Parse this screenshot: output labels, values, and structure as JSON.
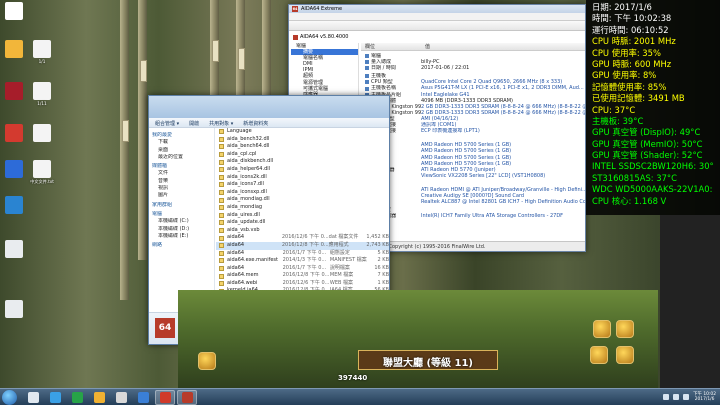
{
  "desktop": {
    "icons": [
      {
        "label": "",
        "color": "#ffffff"
      },
      {
        "label": "",
        "color": "#f2b63a"
      },
      {
        "label": "",
        "color": "#a61d2a"
      },
      {
        "label": "",
        "color": "#d33a2f"
      },
      {
        "label": "",
        "color": "#2d6bd8"
      },
      {
        "label": "",
        "color": "#2a84d1"
      },
      {
        "label": "",
        "color": "#e9ecef"
      },
      {
        "label": "",
        "color": "#e9ecef"
      }
    ],
    "col2_labels": [
      "1/1",
      "1/11",
      "",
      "中文文件.txt"
    ]
  },
  "osd": {
    "lines": [
      {
        "text": "日期: 2017/1/6",
        "color": "#ffffff"
      },
      {
        "text": "時間: 下午 10:02:38",
        "color": "#ffffff"
      },
      {
        "text": "運行時間: 06:10:52",
        "color": "#ffffff"
      },
      {
        "text": "CPU 時脈: 2001 MHz",
        "color": "#ffff00"
      },
      {
        "text": "CPU 使用率: 35%",
        "color": "#ffff00"
      },
      {
        "text": "GPU 時脈: 600 MHz",
        "color": "#ffff00"
      },
      {
        "text": "GPU 使用率: 8%",
        "color": "#ffff00"
      },
      {
        "text": "記憶體使用率: 85%",
        "color": "#ffff00"
      },
      {
        "text": "已使用記憶體: 3491 MB",
        "color": "#ffff00"
      },
      {
        "text": "CPU: 37°C",
        "color": "#ffff00"
      },
      {
        "text": "主機板: 39°C",
        "color": "#00ff00"
      },
      {
        "text": "GPU 真空管 (DispIO): 49°C",
        "color": "#00ff00"
      },
      {
        "text": "GPU 真空管 (MemIO): 50°C",
        "color": "#00ff00"
      },
      {
        "text": "GPU 真空管 (Shader): 52°C",
        "color": "#00ff00"
      },
      {
        "text": "INTEL SSDSC2BW120H6: 30°C",
        "color": "#00ff00"
      },
      {
        "text": "ST3160815AS: 37°C",
        "color": "#00ff00"
      },
      {
        "text": "WDC WD5000AAKS-22V1A0: 35°C",
        "color": "#00ff00"
      },
      {
        "text": "CPU 核心: 1.168 V",
        "color": "#00ff00"
      }
    ]
  },
  "aida": {
    "title": "AIDA64 Extreme",
    "version": "AIDA64 v5.80.4000",
    "tree": [
      {
        "label": "電腦",
        "cls": "open"
      },
      {
        "label": "摘要",
        "cls": "child selt"
      },
      {
        "label": "電腦名稱",
        "cls": "child"
      },
      {
        "label": "DMI",
        "cls": "child"
      },
      {
        "label": "IPMI",
        "cls": "child"
      },
      {
        "label": "超頻",
        "cls": "child"
      },
      {
        "label": "電源管理",
        "cls": "child"
      },
      {
        "label": "可攜式電腦",
        "cls": "child"
      },
      {
        "label": "感應器",
        "cls": "child"
      },
      {
        "label": "主機板",
        "cls": ""
      },
      {
        "label": "作業系統",
        "cls": ""
      },
      {
        "label": "伺服器",
        "cls": ""
      },
      {
        "label": "顯示",
        "cls": ""
      },
      {
        "label": "多媒體",
        "cls": ""
      },
      {
        "label": "存放裝置",
        "cls": ""
      },
      {
        "label": "網路",
        "cls": ""
      },
      {
        "label": "DirectX",
        "cls": ""
      },
      {
        "label": "裝置",
        "cls": ""
      },
      {
        "label": "軟體",
        "cls": ""
      },
      {
        "label": "安全性",
        "cls": ""
      },
      {
        "label": "組態",
        "cls": ""
      },
      {
        "label": "資料庫",
        "cls": ""
      },
      {
        "label": "效能測試",
        "cls": ""
      }
    ],
    "columns": [
      "欄位",
      "值"
    ],
    "rows": [
      {
        "k": "電腦",
        "v": "",
        "group": true
      },
      {
        "k": "量入總成",
        "v": "billy-PC",
        "plain": true
      },
      {
        "k": "日期 / 時間",
        "v": "2017-01-06 / 22:01",
        "plain": true
      },
      {
        "k": "主機板",
        "v": "",
        "group": true
      },
      {
        "k": "CPU 類型",
        "v": "QuadCore Intel Core 2 Quad Q9650, 2666 MHz (8 x 333)"
      },
      {
        "k": "主機板名稱",
        "v": "Asus P5G41T-M LX (1 PCI-E x16, 1 PCI-E x1, 2 DDR3 DIMM, Aud..."
      },
      {
        "k": "主機板晶片組",
        "v": "Intel Eaglelake G41"
      },
      {
        "k": "系統記憶體",
        "v": "4096 MB (DDR3-1333 DDR3 SDRAM)",
        "plain": true
      },
      {
        "k": "DIMM1: Kingston 99U5403-1...",
        "v": "2 GB DDR3-1333 DDR3 SDRAM (8-8-8-24 @ 666 MHz) (8-8-8-22 @..."
      },
      {
        "k": "DIMM3: Kingston 99U5403-1...",
        "v": "2 GB DDR3-1333 DDR3 SDRAM (8-8-8-24 @ 666 MHz) (8-8-8-22 @..."
      },
      {
        "k": "BIOS 類型",
        "v": "AMI (04/16/12)"
      },
      {
        "k": "通訊埠連接",
        "v": "通訊埠 (COM1)"
      },
      {
        "k": "通訊埠連接",
        "v": "ECP 印表機連接埠 (LPT1)"
      },
      {
        "k": "顯示",
        "v": "",
        "group": true
      },
      {
        "k": "顯示卡",
        "v": "AMD Radeon HD 5700 Series (1 GB)"
      },
      {
        "k": "顯示卡",
        "v": "AMD Radeon HD 5700 Series (1 GB)"
      },
      {
        "k": "顯示卡",
        "v": "AMD Radeon HD 5700 Series (1 GB)"
      },
      {
        "k": "顯示卡",
        "v": "AMD Radeon HD 5700 Series (1 GB)"
      },
      {
        "k": "3D 加速器",
        "v": "ATI Radeon HD 5770 (Juniper)"
      },
      {
        "k": "顯示器",
        "v": "ViewSonic VX2208 Series [22\" LCD] (VST1H0808)"
      },
      {
        "k": "多媒體",
        "v": "",
        "group": true
      },
      {
        "k": "音效卡",
        "v": "ATI Radeon HDMI @ ATI Juniper/Broadway/Granville - High Defini..."
      },
      {
        "k": "音效卡",
        "v": "Creative Audigy SE [0000?D] Sound Card"
      },
      {
        "k": "音效卡",
        "v": "Realtek ALC887 @ Intel 82801 GB ICH7 - High Definition Audio Con..."
      },
      {
        "k": "存放裝置",
        "v": "",
        "group": true
      },
      {
        "k": "IDE 控制器",
        "v": "Intel(R) ICH7 Family Ultra ATA Storage Controllers - 27DF"
      }
    ],
    "status": "Copyright (c) 1995-2016 FinalWire Ltd."
  },
  "explorer": {
    "toolbar": [
      "組合管理 ▾",
      "開啟",
      "共用對象 ▾",
      "新增資料夾"
    ],
    "nav": [
      {
        "label": "我的最愛",
        "sec": true
      },
      {
        "label": "下載",
        "sec": false
      },
      {
        "label": "桌面",
        "sec": false
      },
      {
        "label": "最近的位置",
        "sec": false
      },
      {
        "label": "媒體櫃",
        "sec": true
      },
      {
        "label": "文件",
        "sec": false
      },
      {
        "label": "音樂",
        "sec": false
      },
      {
        "label": "視訊",
        "sec": false
      },
      {
        "label": "圖片",
        "sec": false
      },
      {
        "label": "家用群組",
        "sec": true
      },
      {
        "label": "電腦",
        "sec": true
      },
      {
        "label": "本機磁碟 (C:)",
        "sec": false
      },
      {
        "label": "本機磁碟 (D:)",
        "sec": false
      },
      {
        "label": "本機磁碟 (E:)",
        "sec": false
      },
      {
        "label": "網路",
        "sec": true
      }
    ],
    "files": [
      {
        "name": "Language",
        "date": "",
        "type": "",
        "size": ""
      },
      {
        "name": "aida_bench32.dll",
        "date": "",
        "type": "",
        "size": ""
      },
      {
        "name": "aida_bench64.dll",
        "date": "",
        "type": "",
        "size": ""
      },
      {
        "name": "aida_cpl.cpl",
        "date": "",
        "type": "",
        "size": ""
      },
      {
        "name": "aida_diskbench.dll",
        "date": "",
        "type": "",
        "size": ""
      },
      {
        "name": "aida_helper64.dll",
        "date": "",
        "type": "",
        "size": ""
      },
      {
        "name": "aida_icons2k.dll",
        "date": "",
        "type": "",
        "size": ""
      },
      {
        "name": "aida_icons7.dll",
        "date": "",
        "type": "",
        "size": ""
      },
      {
        "name": "aida_iconsxp.dll",
        "date": "",
        "type": "",
        "size": ""
      },
      {
        "name": "aida_mondiag.dll",
        "date": "",
        "type": "",
        "size": ""
      },
      {
        "name": "aida_mondiag",
        "date": "",
        "type": "",
        "size": ""
      },
      {
        "name": "aida_uires.dll",
        "date": "",
        "type": "",
        "size": ""
      },
      {
        "name": "aida_update.dll",
        "date": "",
        "type": "",
        "size": ""
      },
      {
        "name": "aida_vsb.vxb",
        "date": "",
        "type": "",
        "size": ""
      },
      {
        "name": "aida64",
        "date": "2016/12/6 下午 0...",
        "type": "dat 檔案文件",
        "size": "1,452 KB",
        "sel": false
      },
      {
        "name": "aida64",
        "date": "2016/12/8 下午 0...",
        "type": "應用程式",
        "size": "2,743 KB",
        "sel": true
      },
      {
        "name": "aida64",
        "date": "2016/1/7 下午 0...",
        "type": "組態設定",
        "size": "5 KB"
      },
      {
        "name": "aida64.exe.manifest",
        "date": "2014/1/3 下午 0...",
        "type": "MANIFEST 檔案",
        "size": "2 KB"
      },
      {
        "name": "aida64",
        "date": "2016/1/7 下午 0...",
        "type": "說明檔案",
        "size": "16 KB"
      },
      {
        "name": "aida64.mem",
        "date": "2016/12/8 下午 0...",
        "type": "MEM 檔案",
        "size": "7 KB"
      },
      {
        "name": "aida64.webi",
        "date": "2016/12/6 下午 0...",
        "type": "WEB 檔案",
        "size": "1 KB"
      },
      {
        "name": "kerneld.ia64",
        "date": "2016/12/8 下午 0...",
        "type": "IA64 檔案",
        "size": "56 KB"
      },
      {
        "name": "kerneld.w9x",
        "date": "2016/12/8 下午 0...",
        "type": "W9X 檔案",
        "size": "1 KB"
      }
    ],
    "detail": {
      "name": "aida64",
      "type": "應用程式",
      "modified": "修改日期: 2016/12/8 下午 07:53",
      "size": "大小: 3.65 MB",
      "created": "建立日期: 2016/2/12 下午 07:53"
    },
    "icon_text": "64"
  },
  "game": {
    "title": "聯盟大廳 (等級 11)",
    "score": "397440"
  },
  "taskbar": {
    "apps": [
      {
        "color": "#e0e8f0"
      },
      {
        "color": "#3aa0e6"
      },
      {
        "color": "#27a348"
      },
      {
        "color": "#f0b132"
      },
      {
        "color": "#d9d9d9"
      },
      {
        "color": "#3a7fd6"
      },
      {
        "color": "#d03a2a"
      },
      {
        "color": "#b73b2a"
      }
    ],
    "time": "下午 10:02",
    "date": "2017/1/6"
  }
}
